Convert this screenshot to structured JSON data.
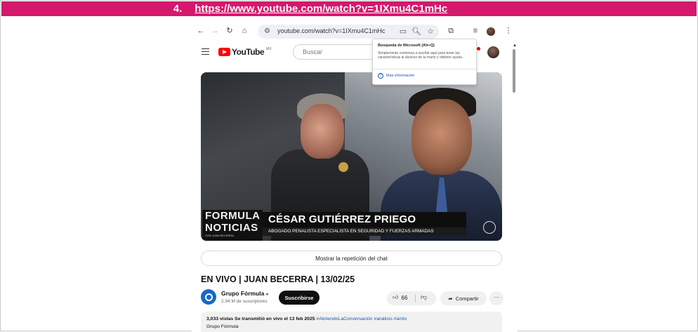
{
  "header": {
    "number": "4.",
    "url": "https://www.youtube.com/watch?v=1IXmu4C1mHc"
  },
  "browser": {
    "address": "youtube.com/watch?v=1IXmu4C1mHc",
    "icons": [
      "back-icon",
      "forward-icon",
      "reload-icon",
      "home-icon",
      "site-settings-icon",
      "cast-icon",
      "zoom-icon",
      "bookmark-star-icon",
      "extensions-icon",
      "reading-list-icon",
      "profile-avatar",
      "menu-icon"
    ]
  },
  "youtube": {
    "logo_text": "YouTube",
    "region": "MX",
    "search_placeholder": "Buscar"
  },
  "popup": {
    "title": "Búsqueda de Microsoft (Alt+Q)",
    "body": "Simplemente comienza a escribir aquí para tener las características al alcance de tu mano y obtener ayuda.",
    "link": "Más información"
  },
  "video": {
    "show_logo_line1": "FORMULA",
    "show_logo_line2": "NOTICIAS",
    "show_logo_line3": "CON JUAN BECERRA",
    "guest_name": "CÉSAR GUTIÉRREZ PRIEGO",
    "guest_role": "ABOGADO PENALISTA ESPECIALISTA EN SEGURIDAD Y FUERZAS ARMADAS"
  },
  "chat_replay_label": "Mostrar la repetición del chat",
  "video_title": "EN VIVO | JUAN BECERRA | 13/02/25",
  "channel": {
    "name": "Grupo Fórmula",
    "subscribers": "2.94 M de suscriptores",
    "subscribe_label": "Suscribirse"
  },
  "actions": {
    "likes": "66",
    "share_label": "Compartir"
  },
  "description": {
    "stats": "3,033 vistas  Se transmitió en vivo el 13 feb 2025",
    "hashtags": "#AbriendoLaConversación #análisis #amlo",
    "line2": "Grupo Fórmula"
  },
  "colors": {
    "accent_bar": "#d6176e",
    "youtube_red": "#ff0000",
    "link_blue": "#1a55b8"
  }
}
